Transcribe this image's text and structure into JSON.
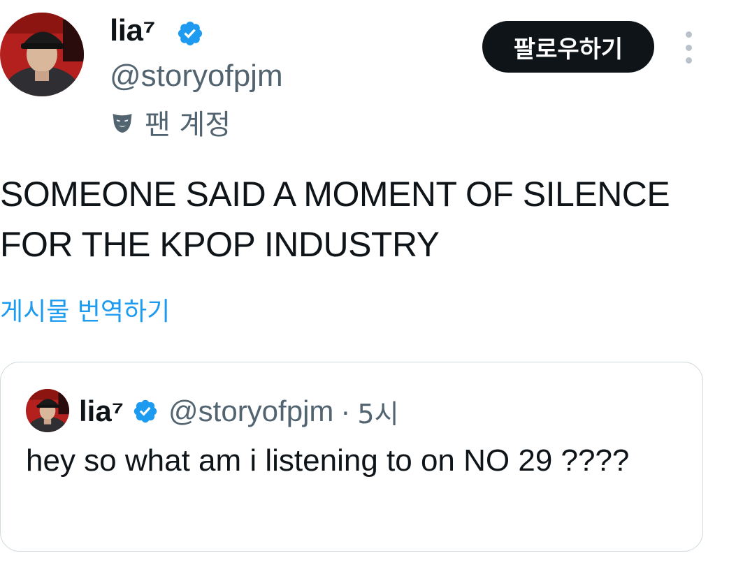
{
  "author": {
    "display_name": "lia⁷",
    "handle": "@storyofpjm",
    "account_label": "팬 계정",
    "avatar_icon": "profile-photo-avatar",
    "verified_icon": "verified-badge-icon",
    "account_label_icon": "theater-mask-icon"
  },
  "actions": {
    "follow_label": "팔로우하기",
    "more_icon": "vertical-ellipsis-icon"
  },
  "post": {
    "text": "SOMEONE SAID A MOMENT OF SILENCE FOR THE KPOP INDUSTRY",
    "translate_label": "게시물 번역하기"
  },
  "quoted_post": {
    "display_name": "lia⁷",
    "handle": "@storyofpjm",
    "separator": "·",
    "time": "5시",
    "text": "hey so what am i listening to on NO 29 ????"
  },
  "colors": {
    "text_primary": "#0f1419",
    "text_secondary": "#536471",
    "link": "#1d9bf0",
    "verified": "#1d9bf0",
    "follow_button_bg": "#0f1419",
    "border": "#cfd9de"
  }
}
